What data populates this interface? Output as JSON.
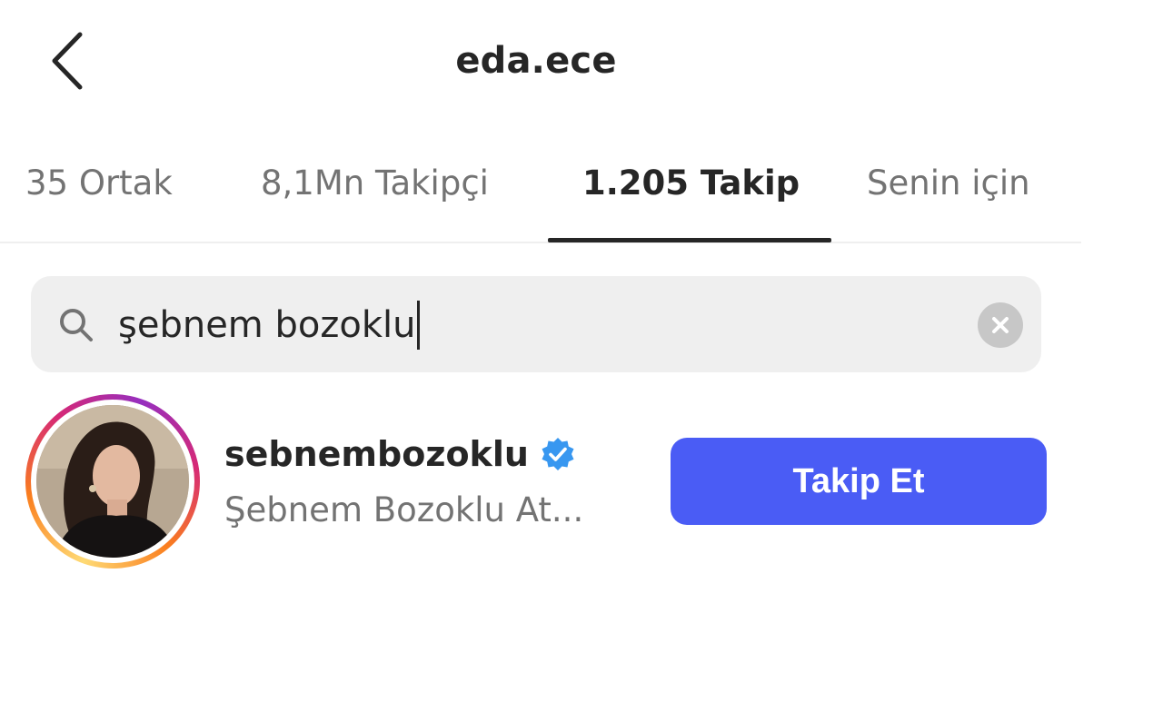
{
  "header": {
    "title": "eda.ece",
    "back_icon": "chevron-left-icon"
  },
  "tabs": [
    {
      "label": "35 Ortak",
      "active": false
    },
    {
      "label": "8,1Mn Takipçi",
      "active": false
    },
    {
      "label": "1.205 Takip",
      "active": true
    },
    {
      "label": "Senin için",
      "active": false
    }
  ],
  "search": {
    "value": "şebnem bozoklu",
    "icon": "search-icon",
    "clear_icon": "clear-icon"
  },
  "results": [
    {
      "username": "sebnembozoklu",
      "verified": true,
      "full_name": "Şebnem Bozoklu At...",
      "follow_label": "Takip Et"
    }
  ],
  "colors": {
    "accent": "#4a5cf5",
    "verified": "#3897f0",
    "text_primary": "#262626",
    "text_secondary": "#737373",
    "search_bg": "#efefef"
  }
}
